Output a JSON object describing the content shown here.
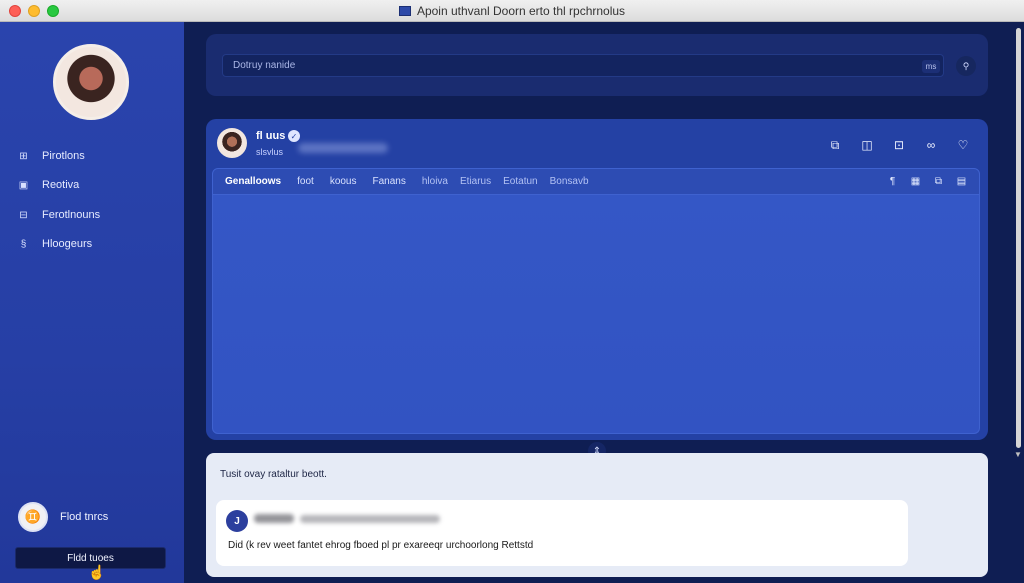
{
  "window": {
    "title": "Apoin uthvanl Doorn erto thl rpchrnolus"
  },
  "sidebar": {
    "items": [
      {
        "label": "Pirotlons",
        "icon": "photos-icon"
      },
      {
        "label": "Reotiva",
        "icon": "calendar-icon"
      },
      {
        "label": "Ferotlnouns",
        "icon": "users-icon"
      },
      {
        "label": "Hloogeurs",
        "icon": "settings-icon"
      }
    ],
    "user_name": "Flod tnrcs",
    "action_button": "Fldd tuoes"
  },
  "search": {
    "placeholder": "Dotruy nanide",
    "shortcut": "ms"
  },
  "post": {
    "author": "fl uus",
    "handle": "slsvlus"
  },
  "tabs": [
    {
      "label": "Genalloows",
      "active": true
    },
    {
      "label": "foot",
      "active": false
    },
    {
      "label": "koous",
      "active": false
    },
    {
      "label": "Fanans",
      "active": false
    },
    {
      "label": "hloiva",
      "active": false
    },
    {
      "label": "Etiarus",
      "active": false
    },
    {
      "label": "Eotatun",
      "active": false
    },
    {
      "label": "Bonsavb",
      "active": false
    }
  ],
  "comments": {
    "title": "Tusit ovay rataltur beott.",
    "avatar_initial": "J",
    "text": "Did (k rev weet fantet ehrog fboed pl pr exareeqr urchoorlong Rettstd"
  },
  "colors": {
    "sidebar": "#2a44ad",
    "background": "#0f1e53",
    "post_body": "#3457c6",
    "comments_bg": "#e6ebf6"
  }
}
